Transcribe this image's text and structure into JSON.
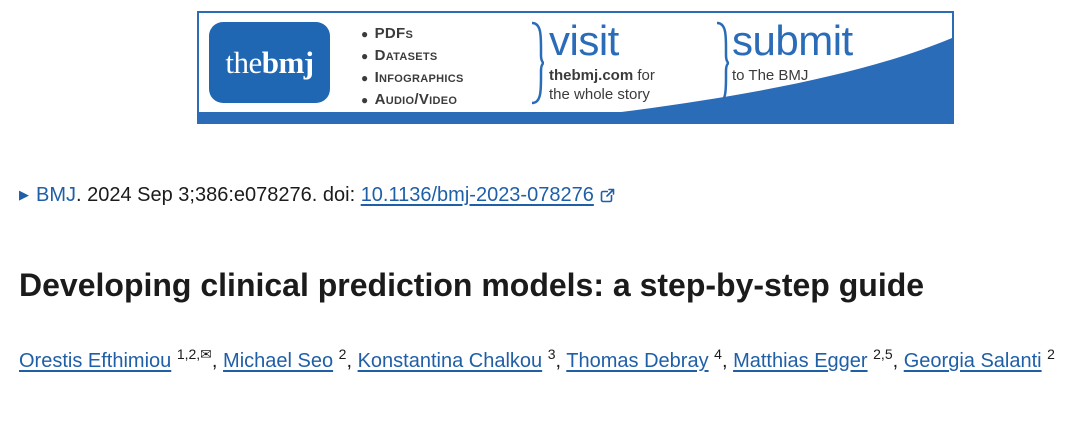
{
  "banner": {
    "logo_prefix": "the",
    "logo_bold": "bmj",
    "formats": [
      "PDFs",
      "Datasets",
      "Infographics",
      "Audio/Video"
    ],
    "visit_word": "visit",
    "visit_site": "thebmj.com",
    "visit_for": " for",
    "visit_tagline": "the whole story",
    "submit_word": "submit",
    "submit_tagline": "to The BMJ",
    "brand_color": "#2a6cb8"
  },
  "citation": {
    "journal": "BMJ",
    "details": ". 2024 Sep 3;386:e078276. doi: ",
    "doi": "10.1136/bmj-2023-078276"
  },
  "article": {
    "title": "Developing clinical prediction models: a step-by-step guide"
  },
  "authors": [
    {
      "name": "Orestis Efthimiou",
      "aff": "1,2,✉"
    },
    {
      "name": "Michael Seo",
      "aff": "2"
    },
    {
      "name": "Konstantina Chalkou",
      "aff": "3"
    },
    {
      "name": "Thomas Debray",
      "aff": "4"
    },
    {
      "name": "Matthias Egger",
      "aff": "2,5"
    },
    {
      "name": "Georgia Salanti",
      "aff": "2"
    }
  ],
  "colors": {
    "link": "#1f5fa8",
    "text": "#1b1b1b"
  }
}
